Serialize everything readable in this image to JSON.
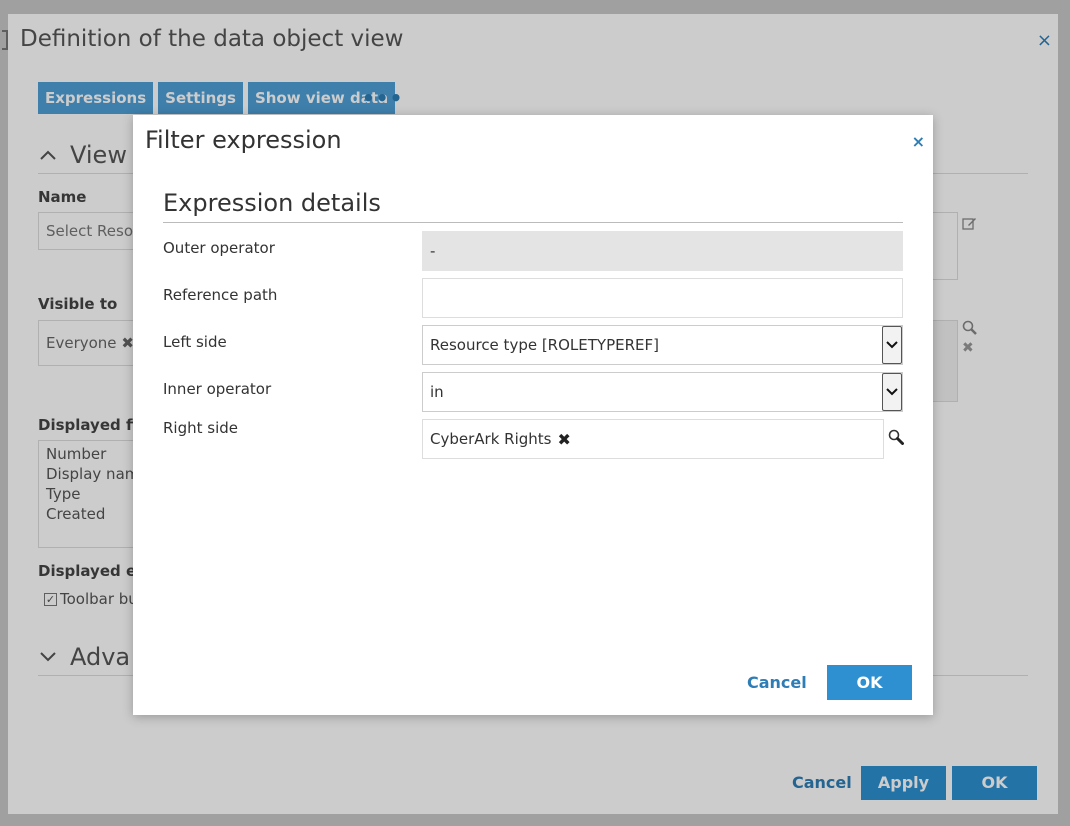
{
  "background": {
    "title": "Definition of the data object view",
    "close_glyph": "×",
    "tabs": [
      "Expressions",
      "Settings",
      "Show view data"
    ],
    "more_glyph": "•••",
    "section_view": "View",
    "name_label": "Name",
    "name_value": "Select Resou",
    "visible_to_label": "Visible to",
    "visible_to_tag": "Everyone",
    "tag_remove_glyph": "✖",
    "displayed_fields_label": "Displayed fiel",
    "displayed_fields": [
      "Number",
      "Display name",
      "Type",
      "Created"
    ],
    "displayed_elements_label": "Displayed ele",
    "toolbar_checkbox_label": "Toolbar bu",
    "section_advanced": "Adva",
    "footer": {
      "cancel": "Cancel",
      "apply": "Apply",
      "ok": "OK"
    }
  },
  "modal": {
    "title": "Filter expression",
    "close_glyph": "×",
    "section_title": "Expression details",
    "fields": {
      "outer_operator": {
        "label": "Outer operator",
        "value": "-"
      },
      "reference_path": {
        "label": "Reference path",
        "value": ""
      },
      "left_side": {
        "label": "Left side",
        "value": "Resource type [ROLETYPEREF]"
      },
      "inner_operator": {
        "label": "Inner operator",
        "value": "in"
      },
      "right_side": {
        "label": "Right side",
        "tag": "CyberArk Rights",
        "remove_glyph": "✖"
      }
    },
    "buttons": {
      "cancel": "Cancel",
      "ok": "OK"
    }
  },
  "colors": {
    "accent": "#2e90d1",
    "link": "#2e7db5",
    "tab_bg": "#4e9fd6",
    "disabled_btn": "#8fbfe0"
  }
}
